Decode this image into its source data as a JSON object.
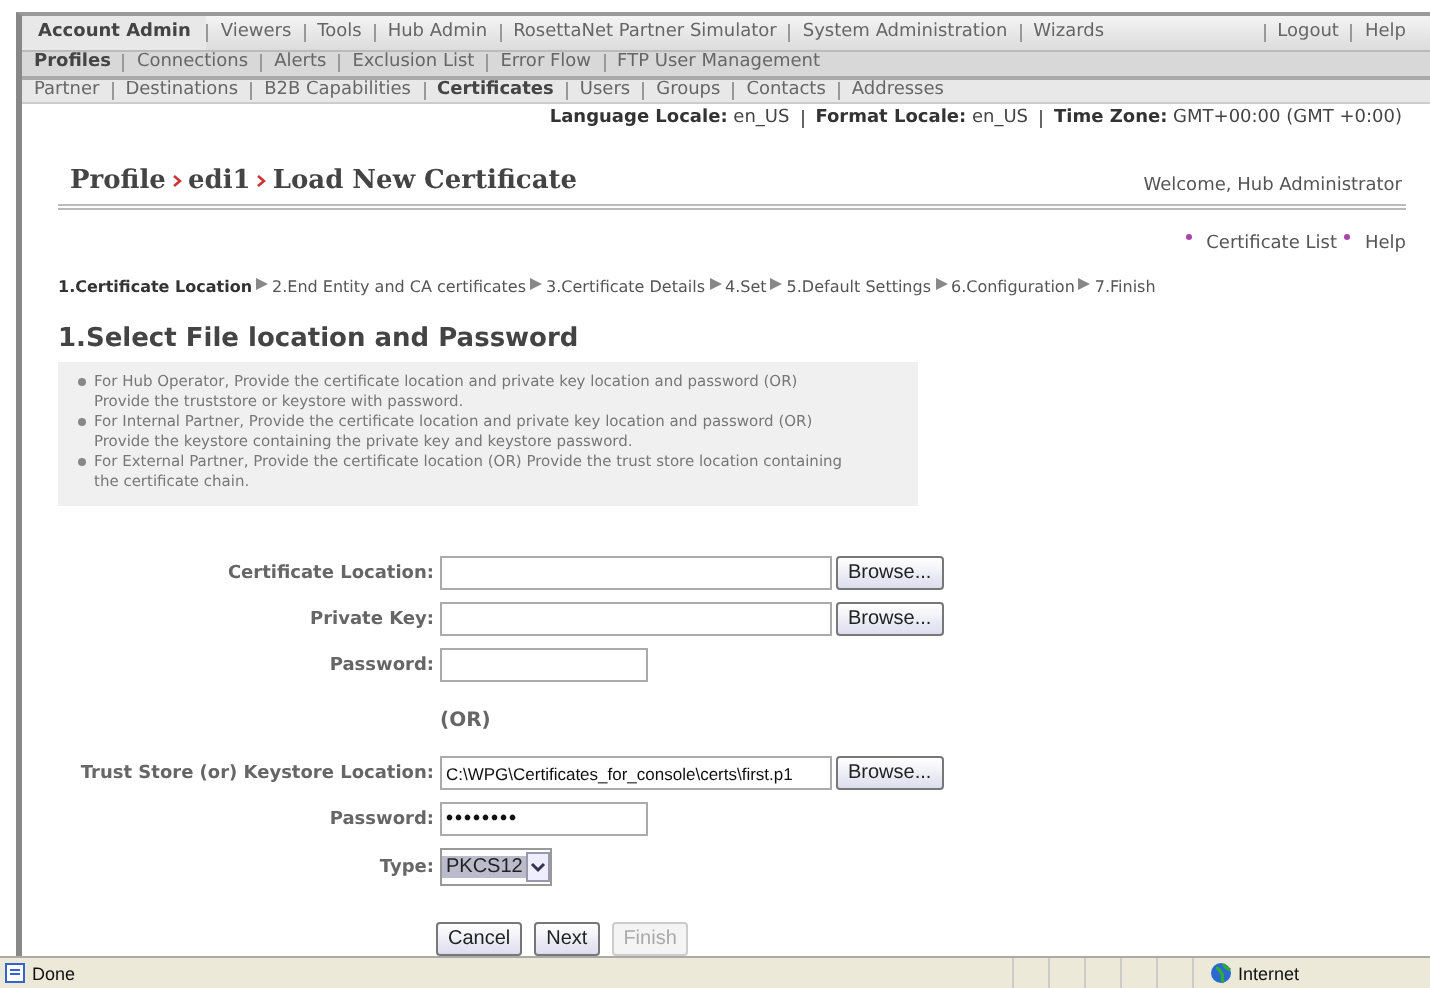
{
  "menu_top": {
    "items": [
      {
        "label": "Account Admin",
        "selected": true
      },
      {
        "label": "Viewers",
        "selected": false
      },
      {
        "label": "Tools",
        "selected": false
      },
      {
        "label": "Hub Admin",
        "selected": false
      },
      {
        "label": "RosettaNet Partner Simulator",
        "selected": false
      },
      {
        "label": "System Administration",
        "selected": false
      },
      {
        "label": "Wizards",
        "selected": false
      }
    ],
    "links": [
      "Logout",
      "Help"
    ]
  },
  "menu_second": [
    {
      "label": "Profiles",
      "selected": true
    },
    {
      "label": "Connections",
      "selected": false
    },
    {
      "label": "Alerts",
      "selected": false
    },
    {
      "label": "Exclusion List",
      "selected": false
    },
    {
      "label": "Error Flow",
      "selected": false
    },
    {
      "label": "FTP User Management",
      "selected": false
    }
  ],
  "menu_third": [
    {
      "label": "Partner",
      "selected": false
    },
    {
      "label": "Destinations",
      "selected": false
    },
    {
      "label": "B2B Capabilities",
      "selected": false
    },
    {
      "label": "Certificates",
      "selected": true
    },
    {
      "label": "Users",
      "selected": false
    },
    {
      "label": "Groups",
      "selected": false
    },
    {
      "label": "Contacts",
      "selected": false
    },
    {
      "label": "Addresses",
      "selected": false
    }
  ],
  "locale": [
    {
      "label": "Language Locale:",
      "value": "en_US"
    },
    {
      "label": "Format Locale:",
      "value": "en_US"
    },
    {
      "label": "Time Zone:",
      "value": "GMT+00:00 (GMT +0:00)"
    }
  ],
  "breadcrumb": [
    "Profile",
    "edi1",
    "Load New Certificate"
  ],
  "welcome": "Welcome, Hub Administrator",
  "page_links": [
    "Certificate List",
    "Help"
  ],
  "steps": [
    {
      "label": "1.Certificate Location",
      "selected": true
    },
    {
      "label": "2.End Entity and CA certificates",
      "selected": false
    },
    {
      "label": "3.Certificate Details",
      "selected": false
    },
    {
      "label": "4.Set",
      "selected": false
    },
    {
      "label": "5.Default Settings",
      "selected": false
    },
    {
      "label": "6.Configuration",
      "selected": false
    },
    {
      "label": "7.Finish",
      "selected": false
    }
  ],
  "heading": "1.Select File location and Password",
  "notes": [
    "For Hub Operator, Provide the certificate location and private key location and password (OR) Provide the truststore or keystore with password.",
    "For Internal Partner, Provide the certificate location and private key location and password (OR) Provide the keystore containing the private key and keystore password.",
    "For External Partner, Provide the certificate location (OR) Provide the trust store location containing the certificate chain."
  ],
  "form": [
    {
      "kind": "file",
      "label": "Certificate Location:",
      "button": "Browse..."
    },
    {
      "kind": "file",
      "label": "Private Key:",
      "button": "Browse..."
    },
    {
      "kind": "password",
      "label": "Password:"
    },
    {
      "kind": "or",
      "text": "(OR)"
    },
    {
      "kind": "file",
      "label": "Trust Store (or) Keystore Location:",
      "value": "C:\\WPG\\Certificates_for_console\\certs\\first.p1",
      "button": "Browse..."
    },
    {
      "kind": "password",
      "label": "Password:",
      "value": "••••••••"
    },
    {
      "kind": "select",
      "label": "Type:",
      "value": "PKCS12"
    }
  ],
  "buttons": [
    {
      "label": "Cancel",
      "disabled": false
    },
    {
      "label": "Next",
      "disabled": false
    },
    {
      "label": "Finish",
      "disabled": true
    }
  ],
  "status_bar": {
    "text": "Done",
    "zone": "Internet"
  }
}
